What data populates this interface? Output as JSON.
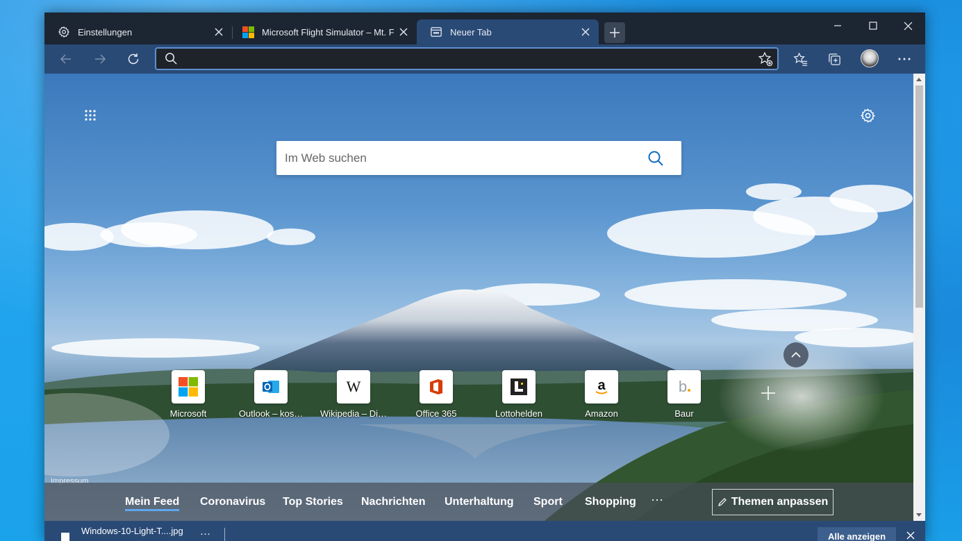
{
  "window": {
    "tabs": [
      {
        "title": "Einstellungen",
        "icon": "gear-icon",
        "active": false
      },
      {
        "title": "Microsoft Flight Simulator – Mt. Fuji",
        "icon": "microsoft-logo-icon",
        "active": false
      },
      {
        "title": "Neuer Tab",
        "icon": "new-tab-page-icon",
        "active": true
      }
    ],
    "controls": {
      "minimize": "–",
      "maximize": "□",
      "close": "✕"
    }
  },
  "toolbar": {
    "address_value": "",
    "icons": [
      "back-arrow-icon",
      "forward-arrow-icon",
      "refresh-icon",
      "search-icon",
      "add-favorite-icon",
      "favorites-icon",
      "collections-icon",
      "profile-avatar",
      "more-icon"
    ]
  },
  "newtab": {
    "search_placeholder": "Im Web suchen",
    "impressum": "Impressum",
    "tiles": [
      {
        "label": "Microsoft",
        "icon": "microsoft-logo-icon"
      },
      {
        "label": "Outlook – kos…",
        "icon": "outlook-icon"
      },
      {
        "label": "Wikipedia – Di…",
        "icon": "wikipedia-icon"
      },
      {
        "label": "Office 365",
        "icon": "office-icon"
      },
      {
        "label": "Lottohelden",
        "icon": "lottohelden-icon"
      },
      {
        "label": "Amazon",
        "icon": "amazon-icon"
      },
      {
        "label": "Baur",
        "icon": "baur-icon"
      }
    ],
    "feed": {
      "tabs": [
        "Mein Feed",
        "Coronavirus",
        "Top Stories",
        "Nachrichten",
        "Unterhaltung",
        "Sport",
        "Shopping"
      ],
      "active_tab": "Mein Feed",
      "more": "···",
      "themes_button": "Themen anpassen"
    }
  },
  "downloads": {
    "file_name": "Windows-10-Light-T....jpg",
    "more": "···",
    "show_all": "Alle anzeigen"
  },
  "colors": {
    "tabstrip": "#1c2532",
    "toolbar": "#2a4a76",
    "accent": "#5ea8ee",
    "desktop": "#1b8fe0"
  }
}
